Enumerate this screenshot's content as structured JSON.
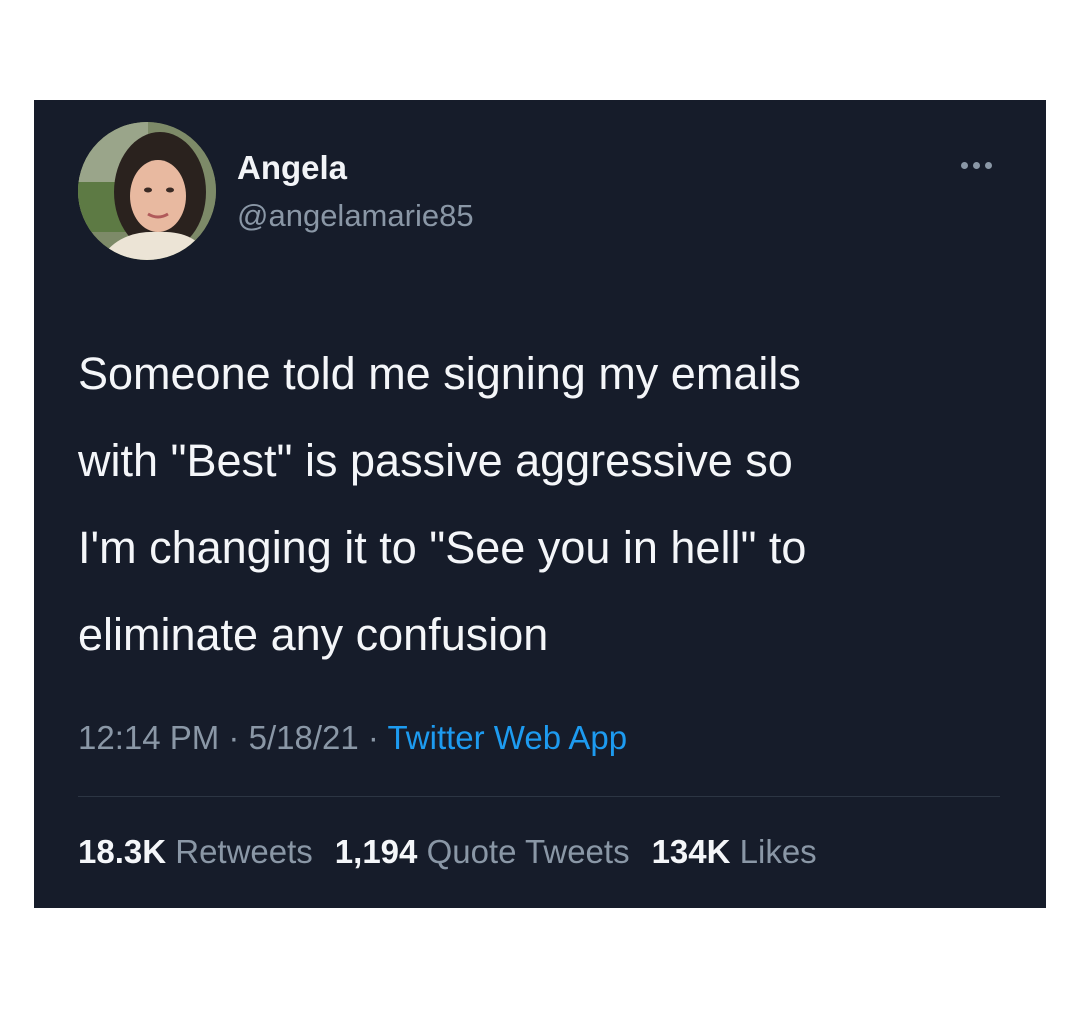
{
  "tweet": {
    "author": {
      "name": "Angela",
      "handle": "@angelamarie85",
      "avatar": "avatar-photo"
    },
    "more_icon": "more-horizontal-icon",
    "text_lines": [
      "Someone told me signing my emails",
      "with \"Best\" is passive aggressive so",
      "I'm changing it to \"See you in hell\" to",
      "eliminate any confusion"
    ],
    "time": "12:14 PM",
    "date": "5/18/21",
    "separator": "·",
    "source": "Twitter Web App",
    "stats": {
      "retweets": {
        "value": "18.3K",
        "label": "Retweets"
      },
      "quote_tweets": {
        "value": "1,194",
        "label": "Quote Tweets"
      },
      "likes": {
        "value": "134K",
        "label": "Likes"
      }
    }
  },
  "colors": {
    "card_background": "#161c2a",
    "primary_text": "#f4f6f9",
    "secondary_text": "#8a97a6",
    "link": "#1d9bf0"
  }
}
